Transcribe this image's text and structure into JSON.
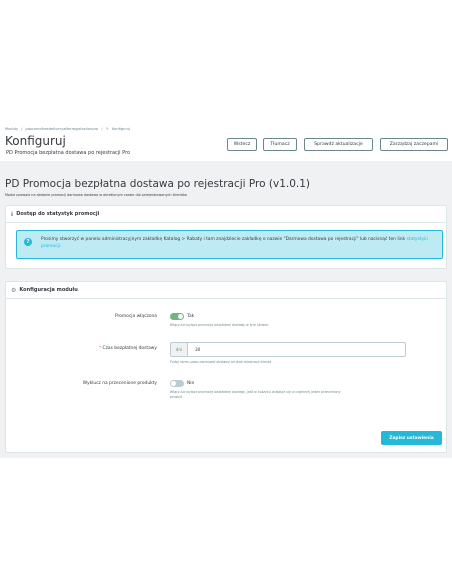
{
  "breadcrumb": {
    "items": [
      "Moduły",
      "/",
      "pdpromofreedeliveryafterregistrationpro",
      "/",
      "Konfiguruj"
    ],
    "edit_icon": "pencil-icon"
  },
  "header": {
    "title": "Konfiguruj",
    "subtitle": "PD Promocja bezpłatna dostawa po rejestracji Pro"
  },
  "toolbar": {
    "back_label": "Wstecz",
    "translate_label": "Tłumacz",
    "check_update_label": "Sprawdź aktualizacje",
    "manage_hooks_label": "Zarządzaj zaczepami"
  },
  "module": {
    "title": "PD Promocja bezpłatna dostawa po rejestracji Pro (v1.0.1)",
    "description": "Moduł pozwala na dodanie promocji darmowa dostawa w określonym czasie dla zarejestrowanych klientów"
  },
  "stats_panel": {
    "heading": "Dostęp do statystyk promocji",
    "icon": "info-icon",
    "alert_text": "Prosimy stworzyć w panelu administracyjnym zakładkę Katalog > Rabaty i tam znajdziecie zakładkę o nazwie \"Darmowa dostawa po rejestracji\" lub nacisnąć ten link",
    "alert_link": "statystyki promocji."
  },
  "config_panel": {
    "heading": "Konfiguracja modułu",
    "icon": "gears-icon",
    "promo_enabled": {
      "label": "Promocja włączona",
      "value_label": "Tak",
      "help": "Włącz lub wyłącz promocję bezpłatnej dostawy w tym sklepie"
    },
    "free_time": {
      "required_mark": "*",
      "label": "Czas bezpłatnej dostawy",
      "addon": "dni",
      "value": "30",
      "help": "Podaj okres czasu darmowej dostawy od dnia rejestracji klienta"
    },
    "exclude_sale": {
      "label": "Wyklucz na przecenione produkty",
      "value_label": "Nie",
      "help_line1": "Włącz lub wyłącz promocję bezpłatnej dostawy, jeśli w koszyku znajduje się co najmniej jeden przeceniony",
      "help_line2": "produkt"
    },
    "save_label": "Zapisz ustawienia"
  },
  "colors": {
    "primary": "#25b9d7",
    "toggle_on": "#70b580",
    "toggle_off": "#bbcdd2",
    "background": "#eff1f2"
  }
}
